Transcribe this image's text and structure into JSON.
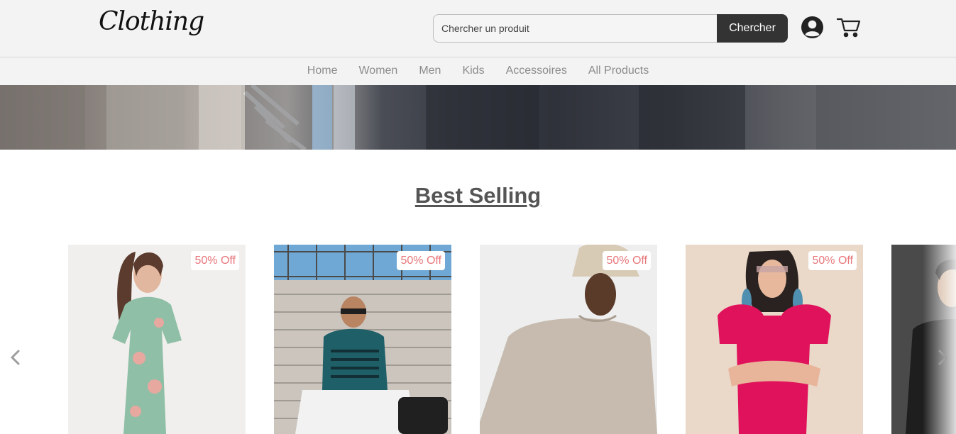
{
  "header": {
    "logo_text": "Clothing",
    "search": {
      "placeholder": "Chercher un produit",
      "button_label": "Chercher"
    },
    "user_icon": "user-circle-icon",
    "cart_icon": "shopping-cart-icon"
  },
  "nav": {
    "items": [
      {
        "label": "Home"
      },
      {
        "label": "Women"
      },
      {
        "label": "Men"
      },
      {
        "label": "Kids"
      },
      {
        "label": "Accessoires"
      },
      {
        "label": "All Products"
      }
    ]
  },
  "best_selling": {
    "title": "Best Selling",
    "products": [
      {
        "badge": "50% Off",
        "image": "woman-floral-maxi-dress"
      },
      {
        "badge": "50% Off",
        "image": "man-teal-striped-tshirt-stairs"
      },
      {
        "badge": "50% Off",
        "image": "man-beige-sweatshirt-bucket-hat"
      },
      {
        "badge": "50% Off",
        "image": "woman-pink-puff-sleeve-dress"
      },
      {
        "badge": "",
        "image": "man-black-shirt"
      }
    ],
    "prev_icon": "chevron-left-icon",
    "next_icon": "chevron-right-icon"
  },
  "colors": {
    "header_bg": "#f3f3f3",
    "search_button_bg": "#333333",
    "nav_text": "#8c8c8c",
    "title_text": "#555555",
    "badge_text": "#e8777b"
  }
}
